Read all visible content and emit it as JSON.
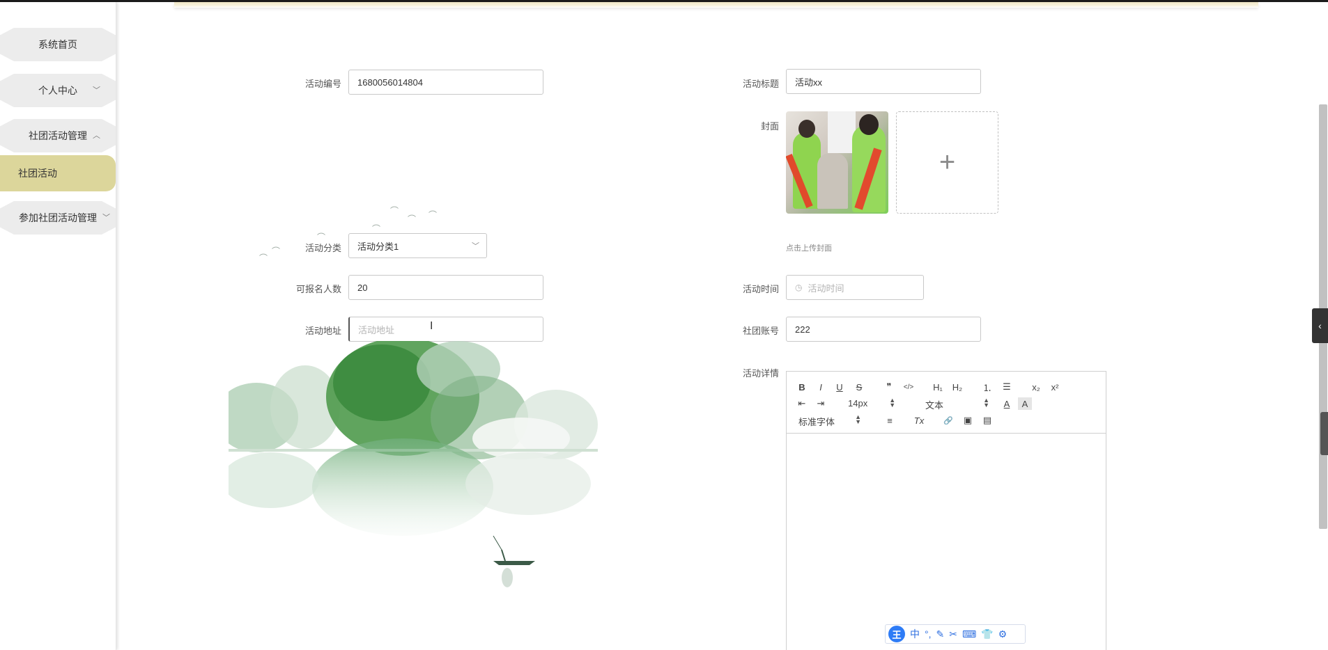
{
  "sidebar": {
    "items": [
      {
        "label": "系统首页"
      },
      {
        "label": "个人中心"
      },
      {
        "label": "社团活动管理"
      },
      {
        "label": "社团活动"
      },
      {
        "label": "参加社团活动管理"
      }
    ]
  },
  "form": {
    "activity_no": {
      "label": "活动编号",
      "value": "1680056014804"
    },
    "activity_title": {
      "label": "活动标题",
      "value": "活动xx"
    },
    "cover": {
      "label": "封面",
      "hint": "点击上传封面"
    },
    "category": {
      "label": "活动分类",
      "value": "活动分类1"
    },
    "capacity": {
      "label": "可报名人数",
      "value": "20"
    },
    "activity_time": {
      "label": "活动时间",
      "placeholder": "活动时间"
    },
    "address": {
      "label": "活动地址",
      "placeholder": "活动地址"
    },
    "club_account": {
      "label": "社团账号",
      "value": "222"
    },
    "details": {
      "label": "活动详情"
    }
  },
  "editor": {
    "font_size": "14px",
    "block_type": "文本",
    "font_family": "标准字体",
    "buttons": {
      "bold": "B",
      "italic": "I",
      "underline": "U",
      "strike": "S",
      "quote": "❞",
      "code": "</>",
      "h1": "H₁",
      "h2": "H₂",
      "ordered_list": "⒈",
      "bullet_list": "☰",
      "subscript": "x₂",
      "superscript": "x²",
      "outdent": "⇤",
      "indent": "⇥",
      "color": "A",
      "background": "A",
      "align": "≡",
      "clean": "Tx",
      "link": "🔗",
      "image": "▣",
      "video": "▤"
    }
  },
  "ime": {
    "logo": "王",
    "items": [
      "中",
      "°,",
      "✎",
      "✂",
      "⌨",
      "👕",
      "⚙"
    ]
  },
  "side_tab": {
    "icon": "‹"
  },
  "colors": {
    "active_nav": "#dcd69b",
    "ime_blue": "#2e7cf6"
  }
}
